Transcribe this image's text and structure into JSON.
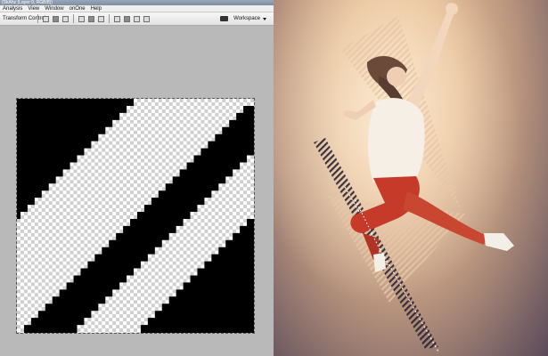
{
  "window": {
    "title": "(SkAhz (Layer 0, RGB/8))"
  },
  "menu": {
    "items": [
      "Analysis",
      "View",
      "Window",
      "onOne",
      "Help"
    ]
  },
  "toolbar": {
    "transform_label": "Transform Controls",
    "workspace_label": "Workspace"
  },
  "colors": {
    "canvas_black": "#000000",
    "checker_light": "#ffffff",
    "checker_dark": "#cfcfcf",
    "artwork_tone": "#e7bf97",
    "stripe": "#e8c7a8"
  },
  "icons": [
    "camera-icon",
    "align-icon",
    "distribute-icon",
    "dropdown-arrow-icon"
  ]
}
